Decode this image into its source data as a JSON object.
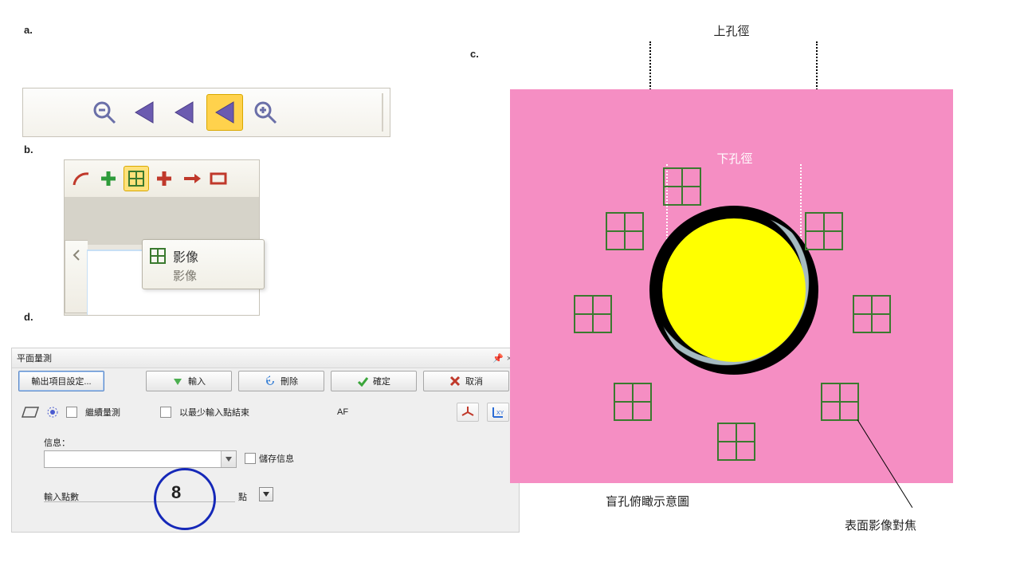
{
  "labels": {
    "a": "a.",
    "b": "b.",
    "c": "c.",
    "d": "d."
  },
  "panel_a": {
    "icons": {
      "zoom_out": "zoom-out-icon",
      "prev3": "nav-back-3-icon",
      "prev2": "nav-back-2-icon",
      "prev1": "nav-back-1-icon",
      "zoom_in": "zoom-in-icon"
    }
  },
  "panel_b": {
    "toolbar_icons": {
      "arc": "arc-icon",
      "plus_green": "plus-green-icon",
      "grid": "grid-icon",
      "plus_red": "plus-red-icon",
      "arrow_right": "arrow-right-icon",
      "rect": "rect-icon"
    },
    "tooltip_title": "影像",
    "tooltip_sub": "影像"
  },
  "panel_d": {
    "title": "平面量測",
    "btn_output_settings": "輸出項目設定...",
    "btn_input": "輸入",
    "btn_delete": "刪除",
    "btn_ok": "確定",
    "btn_cancel": "取消",
    "chk_continuous": "繼續量測",
    "chk_min_points": "以最少輸入點結束",
    "af_label": "AF",
    "msg_label": "信息：",
    "chk_save_msg": "儲存信息",
    "points_label": "輸入點數",
    "points_value": "8",
    "points_unit": "點",
    "combo_value": ""
  },
  "panel_c": {
    "top_label": "上孔徑",
    "inner_label": "下孔徑",
    "bottom_label": "盲孔俯瞰示意圖",
    "focus_label": "表面影像對焦"
  }
}
